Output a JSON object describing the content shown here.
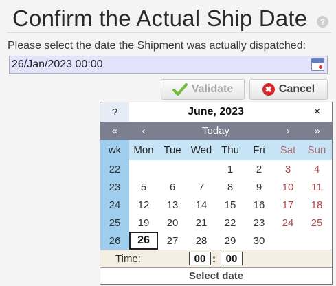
{
  "page": {
    "title": "Confirm the Actual Ship Date",
    "help_glyph": "?",
    "prompt": "Please select the date the Shipment was actually dispatched:"
  },
  "date_input": {
    "value": "26/Jan/2023 00:00",
    "icon": "calendar-icon"
  },
  "buttons": {
    "validate": "Validate",
    "cancel": "Cancel"
  },
  "calendar": {
    "help": "?",
    "title": "June, 2023",
    "close": "×",
    "nav": {
      "prev_year": "«",
      "prev_month": "‹",
      "today": "Today",
      "next_month": "›",
      "next_year": "»"
    },
    "headers": [
      "wk",
      "Mon",
      "Tue",
      "Wed",
      "Thu",
      "Fri",
      "Sat",
      "Sun"
    ],
    "weeks": [
      {
        "wk": "22",
        "days": [
          "",
          "",
          "",
          "1",
          "2",
          "3",
          "4"
        ]
      },
      {
        "wk": "23",
        "days": [
          "5",
          "6",
          "7",
          "8",
          "9",
          "10",
          "11"
        ]
      },
      {
        "wk": "24",
        "days": [
          "12",
          "13",
          "14",
          "15",
          "16",
          "17",
          "18"
        ]
      },
      {
        "wk": "25",
        "days": [
          "19",
          "20",
          "21",
          "22",
          "23",
          "24",
          "25"
        ]
      },
      {
        "wk": "26",
        "days": [
          "26",
          "27",
          "28",
          "29",
          "30",
          "",
          ""
        ]
      }
    ],
    "selected_day": "26",
    "time_label": "Time:",
    "hours": "00",
    "separator": ":",
    "minutes": "00",
    "footer": "Select date"
  },
  "colors": {
    "weekend": "#b04a4a",
    "week_column": "#9ecdee",
    "header_row": "#c7e4f7",
    "nav_bar": "#7b7f8f",
    "input_background": "#e3e3fb"
  }
}
